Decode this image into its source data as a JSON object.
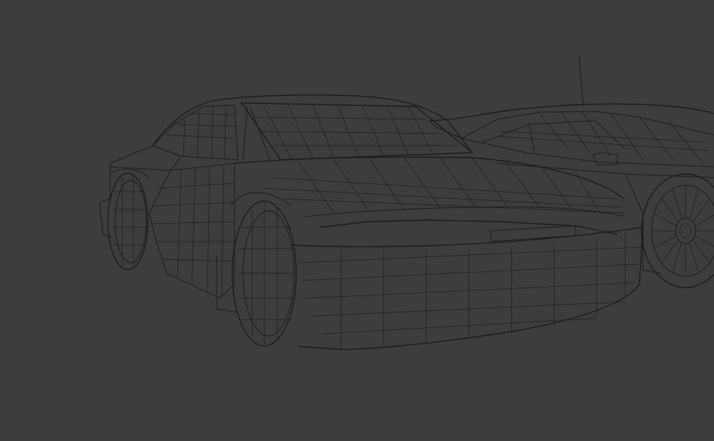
{
  "viewport": {
    "mode": "wireframe",
    "background_color": "#3d3d3d",
    "wire_color": "#1a1a1a"
  },
  "objects": [
    {
      "name": "car-front",
      "kind": "sedan"
    },
    {
      "name": "car-rear",
      "kind": "coupe"
    }
  ]
}
